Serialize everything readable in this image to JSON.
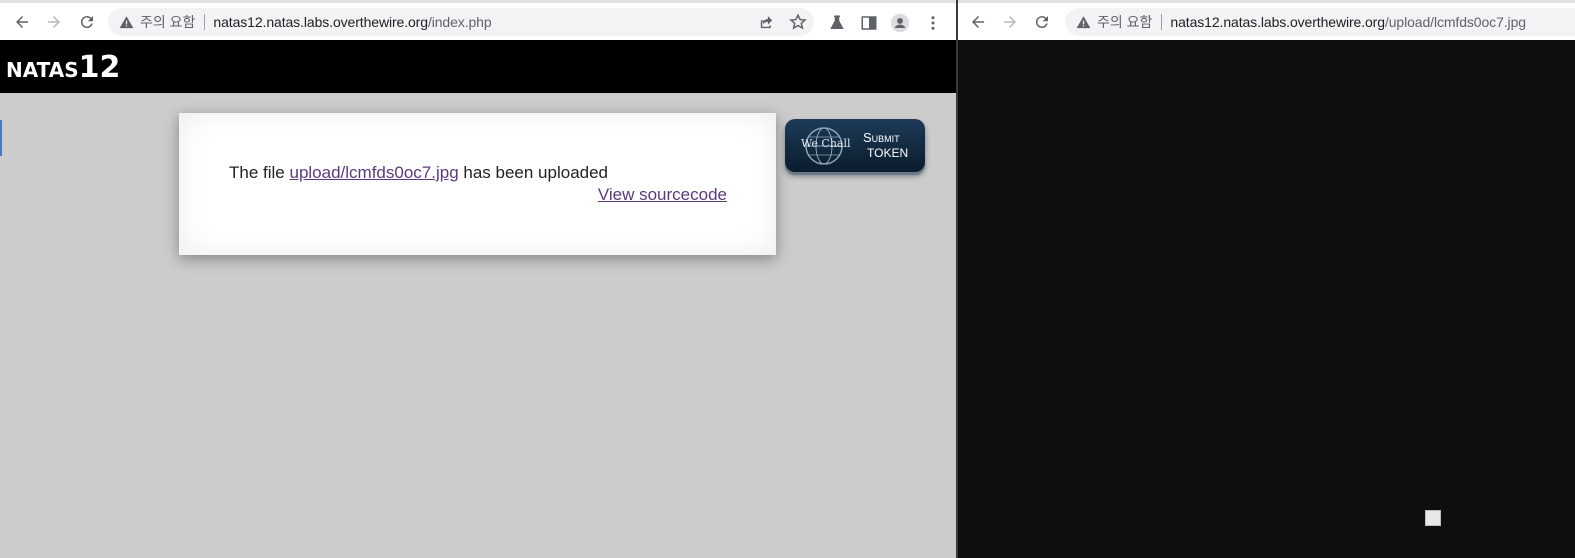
{
  "left_window": {
    "omnibox": {
      "status": "주의 요함",
      "url_host": "natas12.natas.labs.overthewire.org",
      "url_path": "/index.php"
    },
    "page": {
      "title_word": "NATAS",
      "title_number": "12",
      "message_prefix": "The file ",
      "uploaded_link": "upload/lcmfds0oc7.jpg",
      "message_suffix": " has been uploaded",
      "view_source_link": "View sourcecode",
      "wechall": {
        "brand": "We Chall",
        "submit": "Submit",
        "token": "TOKEN"
      }
    }
  },
  "right_window": {
    "omnibox": {
      "status": "주의 요함",
      "url_host": "natas12.natas.labs.overthewire.org",
      "url_path": "/upload/lcmfds0oc7.jpg"
    }
  },
  "colors": {
    "natas_header_bg": "#000000",
    "page_bg": "#cccccc",
    "link_color": "#5d3a7d",
    "image_viewer_bg": "#0e0e0e"
  }
}
